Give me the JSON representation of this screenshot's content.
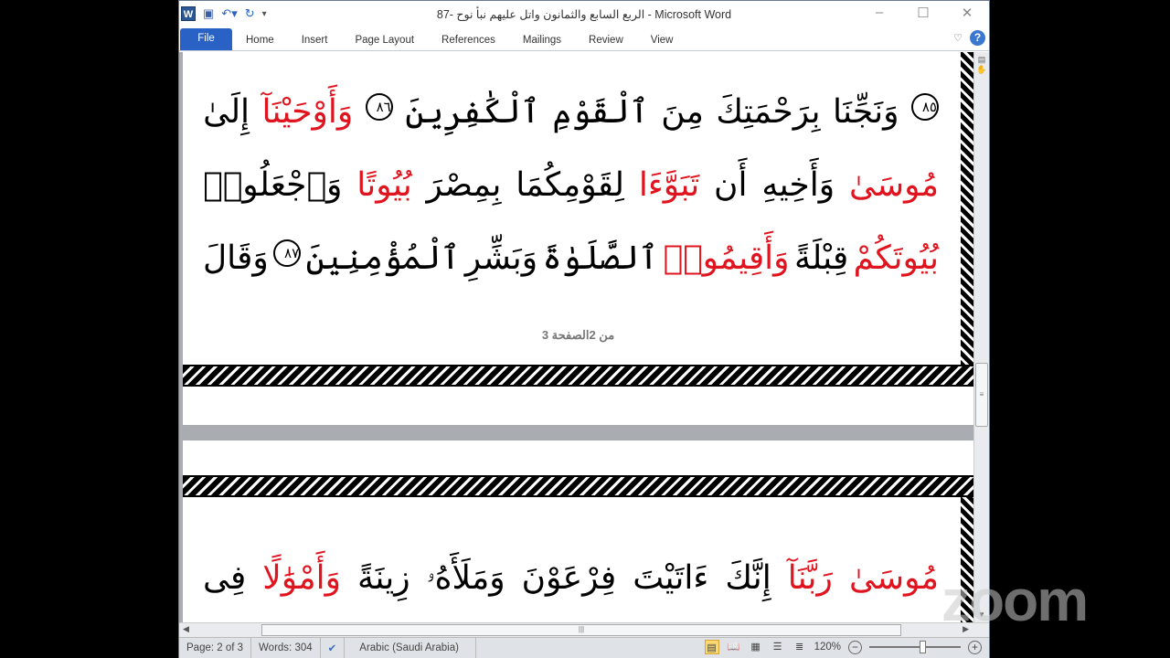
{
  "window": {
    "title": "الربع السابع والثمانون واتل عليهم نبأ نوح -87  -  Microsoft Word",
    "app_icon": "W"
  },
  "ribbon": {
    "tabs": [
      "File",
      "Home",
      "Insert",
      "Page Layout",
      "References",
      "Mailings",
      "Review",
      "View"
    ],
    "help": "?"
  },
  "document": {
    "lines": [
      [
        {
          "t": "٨٥",
          "num": true
        },
        {
          "t": "وَنَجِّنَا"
        },
        {
          "t": "بِرَحْمَتِكَ"
        },
        {
          "t": "مِنَ"
        },
        {
          "t": "ٱلْقَوْمِ"
        },
        {
          "t": "ٱلْكَٰفِرِينَ"
        },
        {
          "t": "٨٦",
          "num": true
        },
        {
          "t": "وَأَوْحَيْنَآ",
          "red": true
        },
        {
          "t": "إِلَىٰ"
        }
      ],
      [
        {
          "t": "مُوسَىٰ",
          "red": true
        },
        {
          "t": "وَأَخِيهِ"
        },
        {
          "t": "أَن"
        },
        {
          "t": "تَبَوَّءَا",
          "red": true
        },
        {
          "t": "لِقَوْمِكُمَا"
        },
        {
          "t": "بِمِصْرَ"
        },
        {
          "t": "بُيُوتًا",
          "red": true
        },
        {
          "t": "وَٱجْعَلُوا۟"
        }
      ],
      [
        {
          "t": "بُيُوتَكُمْ",
          "red": true
        },
        {
          "t": "قِبْلَةً"
        },
        {
          "t": "وَأَقِيمُوا۟",
          "red": true
        },
        {
          "t": "ٱلصَّلَوٰةَ"
        },
        {
          "t": "وَبَشِّرِ"
        },
        {
          "t": "ٱلْمُؤْمِنِينَ"
        },
        {
          "t": "٨٧",
          "num": true
        },
        {
          "t": "وَقَالَ"
        }
      ],
      [
        {
          "t": "مُوسَىٰ",
          "red": true
        },
        {
          "t": "رَبَّنَآ",
          "red": true
        },
        {
          "t": "إِنَّكَ"
        },
        {
          "t": "ءَاتَيْتَ"
        },
        {
          "t": "فِرْعَوْنَ"
        },
        {
          "t": "وَمَلَأَهُۥ"
        },
        {
          "t": "زِينَةً"
        },
        {
          "t": "وَأَمْوَٰلًا",
          "red": true
        },
        {
          "t": "فِى"
        }
      ]
    ],
    "page_footer": "3 من 2الصفحة"
  },
  "status": {
    "page": "Page: 2 of 3",
    "words": "Words: 304",
    "language": "Arabic (Saudi Arabia)",
    "zoom": "120%",
    "zoom_level_percent": 120
  },
  "overlay": {
    "logo": "zoom"
  },
  "colors": {
    "red_text": "#e0141e",
    "file_tab": "#2a61c4"
  }
}
